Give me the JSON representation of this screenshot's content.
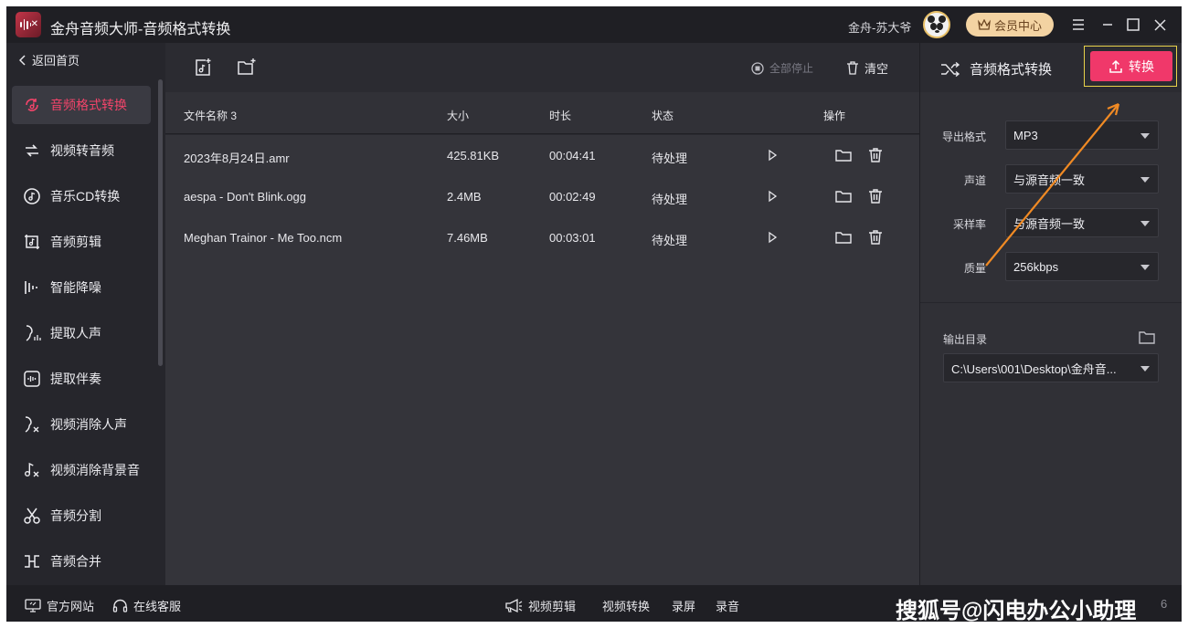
{
  "window": {
    "title": "金舟音频大师-音频格式转换",
    "user_name": "金舟-苏大爷",
    "vip_label": "会员中心"
  },
  "sidebar": {
    "back_label": "返回首页",
    "items": [
      {
        "label": "音频格式转换",
        "active": true
      },
      {
        "label": "视频转音频"
      },
      {
        "label": "音乐CD转换"
      },
      {
        "label": "音频剪辑"
      },
      {
        "label": "智能降噪"
      },
      {
        "label": "提取人声"
      },
      {
        "label": "提取伴奏"
      },
      {
        "label": "视频消除人声"
      },
      {
        "label": "视频消除背景音"
      },
      {
        "label": "音频分割"
      },
      {
        "label": "音频合并"
      }
    ]
  },
  "toolbar": {
    "stop_all_label": "全部停止",
    "clear_label": "清空"
  },
  "table": {
    "headers": {
      "name": "文件名称 3",
      "size": "大小",
      "duration": "时长",
      "status": "状态",
      "actions": "操作"
    },
    "rows": [
      {
        "name": "2023年8月24日.amr",
        "size": "425.81KB",
        "duration": "00:04:41",
        "status": "待处理"
      },
      {
        "name": "aespa - Don't Blink.ogg",
        "size": "2.4MB",
        "duration": "00:02:49",
        "status": "待处理"
      },
      {
        "name": "Meghan Trainor - Me Too.ncm",
        "size": "7.46MB",
        "duration": "00:03:01",
        "status": "待处理"
      }
    ]
  },
  "right_panel": {
    "title": "音频格式转换",
    "convert_label": "转换",
    "fields": [
      {
        "label": "导出格式",
        "value": "MP3"
      },
      {
        "label": "声道",
        "value": "与源音频一致"
      },
      {
        "label": "采样率",
        "value": "与源音频一致"
      },
      {
        "label": "质量",
        "value": "256kbps"
      }
    ],
    "output_dir_label": "输出目录",
    "output_dir_value": "C:\\Users\\001\\Desktop\\金舟音..."
  },
  "bottombar": {
    "website_label": "官方网站",
    "support_label": "在线客服",
    "video_edit_label": "视频剪辑",
    "video_convert_label": "视频转换",
    "screen_record_label": "录屏",
    "audio_record_label": "录音",
    "watermark": "搜狐号@闪电办公小助理",
    "version_peek": "6"
  },
  "colors": {
    "accent": "#f0386a",
    "vip_bg": "#f3d3a2",
    "annotation_arrow": "#f08a24",
    "highlight_box": "#e8d24a"
  }
}
